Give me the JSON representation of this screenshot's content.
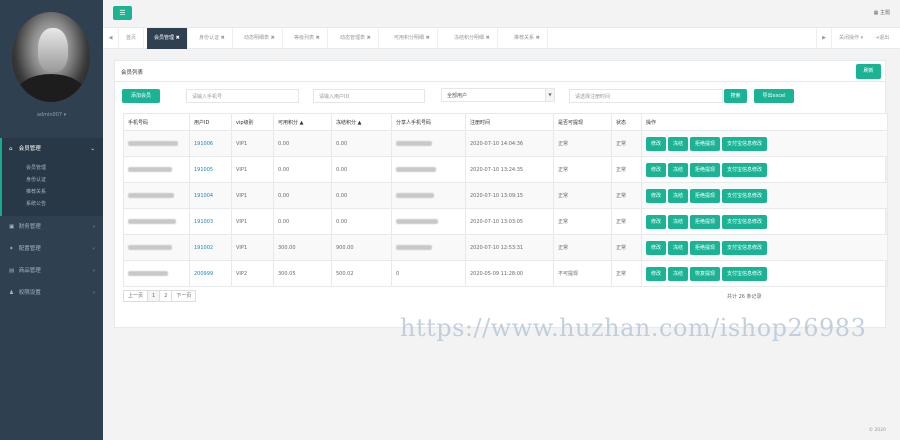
{
  "sidebar": {
    "user_name": "admin007 ▾",
    "menu": [
      {
        "label": "会员管理",
        "icon": "home-icon"
      },
      {
        "label": "财务管理",
        "icon": "wallet-icon"
      },
      {
        "label": "配置管理",
        "icon": "cog-icon"
      },
      {
        "label": "商品管理",
        "icon": "box-icon"
      },
      {
        "label": "权限设置",
        "icon": "user-icon"
      }
    ],
    "submenu": [
      "会员管理",
      "身份认证",
      "推荐关系",
      "系统公告"
    ]
  },
  "header": {
    "menu_toggle": "☰",
    "theme_label": "主题"
  },
  "tabs": {
    "prev": "◀",
    "next": "▶",
    "items": [
      "首页",
      "会员管理 ✖",
      "身份认证 ✖",
      "动态明细表 ✖",
      "等级列表 ✖",
      "动态管理表 ✖",
      "可用积分明细 ✖",
      "冻结积分明细 ✖",
      "推荐关系 ✖"
    ],
    "ops_label": "关闭操作 ▾",
    "logout_label": "退出"
  },
  "panel": {
    "title": "会员列表",
    "refresh_label": "刷新",
    "add_member_label": "添加会员",
    "phone_placeholder": "请输入手机号",
    "uid_placeholder": "请输入用户ID",
    "status_select": "全部用户",
    "time_placeholder": "请选择注册时间",
    "search_label": "搜索",
    "export_label": "导出excel"
  },
  "table": {
    "headers": [
      "手机号码",
      "用户ID",
      "vip级别",
      "可用积分 ▲",
      "冻结积分 ▲",
      "分享人手机号码",
      "注册时间",
      "是否可提现",
      "状态",
      "操作"
    ],
    "rows": [
      {
        "phone": "",
        "uid": "191006",
        "vip": "VIP1",
        "avail": "0.00",
        "frozen": "0.00",
        "ref": "",
        "time": "2020-07-10 14:04:36",
        "withdraw": "正常",
        "status": "正常"
      },
      {
        "phone": "",
        "uid": "191005",
        "vip": "VIP1",
        "avail": "0.00",
        "frozen": "0.00",
        "ref": "",
        "time": "2020-07-10 13:24:35",
        "withdraw": "正常",
        "status": "正常"
      },
      {
        "phone": "",
        "uid": "191004",
        "vip": "VIP1",
        "avail": "0.00",
        "frozen": "0.00",
        "ref": "",
        "time": "2020-07-10 13:09:15",
        "withdraw": "正常",
        "status": "正常"
      },
      {
        "phone": "",
        "uid": "191003",
        "vip": "VIP1",
        "avail": "0.00",
        "frozen": "0.00",
        "ref": "",
        "time": "2020-07-10 13:03:05",
        "withdraw": "正常",
        "status": "正常"
      },
      {
        "phone": "",
        "uid": "191002",
        "vip": "VIP1",
        "avail": "300.00",
        "frozen": "900.00",
        "ref": "",
        "time": "2020-07-10 12:53:31",
        "withdraw": "正常",
        "status": "正常"
      },
      {
        "phone": "",
        "uid": "200999",
        "vip": "VIP2",
        "avail": "300.05",
        "frozen": "500.02",
        "ref": "0",
        "time": "2020-05-09 11:28:00",
        "withdraw": "不可提现",
        "status": "正常"
      }
    ],
    "actions": [
      "修改",
      "冻结",
      "拒绝提现",
      "支付宝信息修改"
    ],
    "actions_alt": [
      "修改",
      "冻结",
      "恢复提现",
      "支付宝信息修改"
    ]
  },
  "pagination": {
    "prev": "上一页",
    "pages": [
      "1",
      "2"
    ],
    "next": "下一页",
    "total": "共计 26 条记录"
  },
  "watermark": "https://www.huzhan.com/ishop26983",
  "footer": "© 2020",
  "colors": {
    "accent": "#1ab394",
    "sidebar": "#2f4050",
    "link": "#1c84c6"
  }
}
